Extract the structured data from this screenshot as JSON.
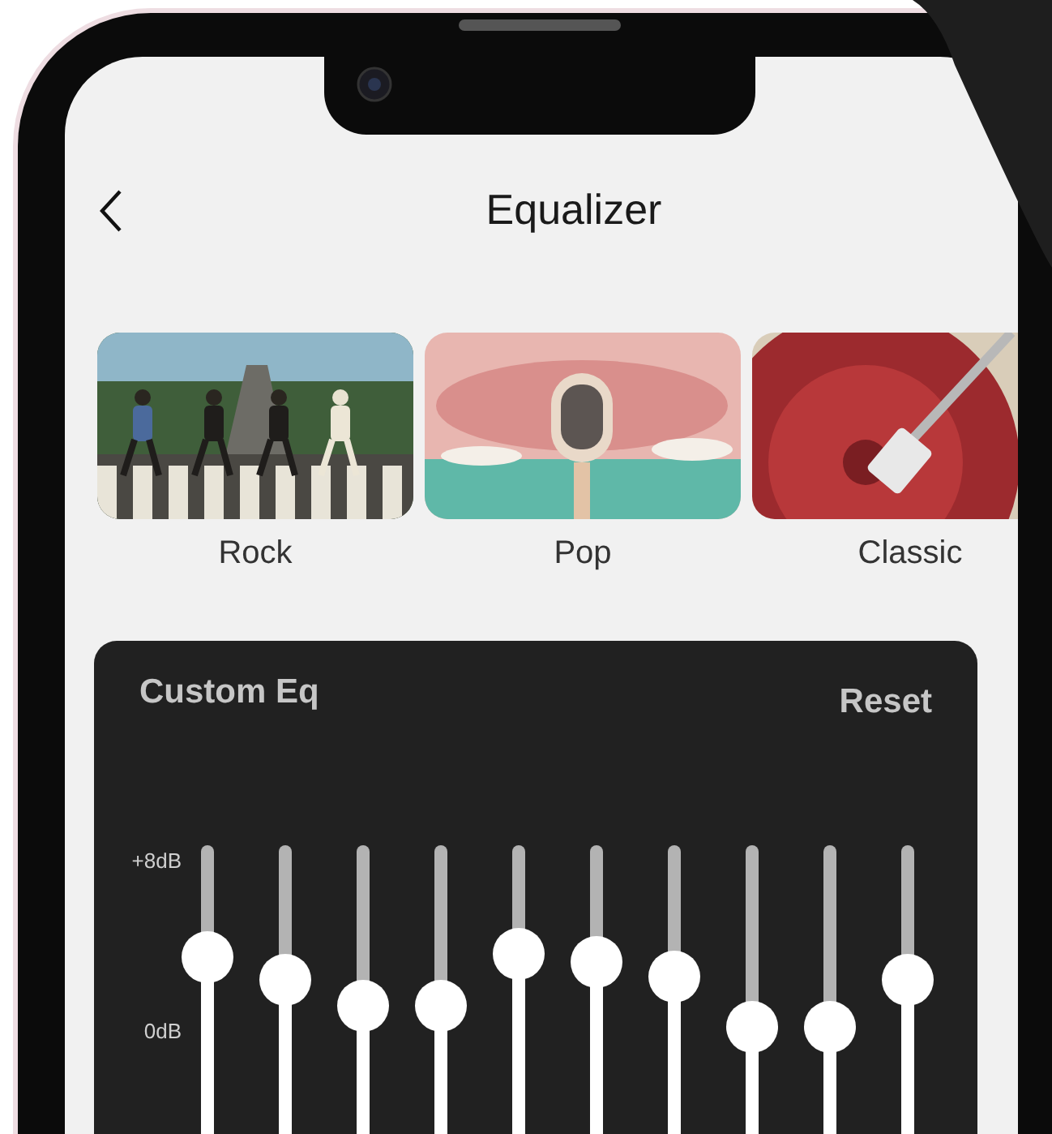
{
  "header": {
    "title": "Equalizer"
  },
  "presets": [
    {
      "label": "Rock"
    },
    {
      "label": "Pop"
    },
    {
      "label": "Classic"
    }
  ],
  "custom_eq": {
    "title": "Custom Eq",
    "reset": "Reset",
    "scale": [
      "+8dB",
      "0dB"
    ],
    "bands": [
      {
        "level": 0.69
      },
      {
        "level": 0.63
      },
      {
        "level": 0.56
      },
      {
        "level": 0.56
      },
      {
        "level": 0.7
      },
      {
        "level": 0.68
      },
      {
        "level": 0.64
      },
      {
        "level": 0.5
      },
      {
        "level": 0.5
      },
      {
        "level": 0.63
      }
    ]
  }
}
